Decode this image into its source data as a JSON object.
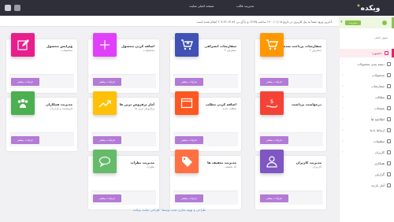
{
  "topbar": {
    "home_link": "صفحه اصلی سایت",
    "template_link": "مدیریت قالب",
    "logo_text": "ویکده"
  },
  "sidebar": {
    "user_badge": "مدیریت",
    "section_header": "منوی اصلی",
    "items": [
      {
        "label": "داشبورد"
      },
      {
        "label": "دسته بندی محصولات"
      },
      {
        "label": "محصولات"
      },
      {
        "label": "سفارشات"
      },
      {
        "label": "مطالب"
      },
      {
        "label": "صفحات"
      },
      {
        "label": "اطلاعیه ها"
      },
      {
        "label": "ارتباط با ما"
      },
      {
        "label": "تنظیمات"
      },
      {
        "label": "کاربران"
      },
      {
        "label": "همکاری"
      },
      {
        "label": "گزارش"
      },
      {
        "label": "آمار بازدید"
      }
    ]
  },
  "notice": "آخرین ورود شما به پنل کاربری در تاریخ ۱۴۰۰/۰۱/۰۵ ساعت ۱۳:۳۵ و با آی پی ۲۰۷.۴۶.۱۳.۸۴ انجام شده است.",
  "detail_button": "جزئیات بیشتر",
  "cards": [
    {
      "title": "سفارشات پرداخت شده",
      "sub": "۲ سفارش",
      "color": "#ff9800",
      "icon": "cart-icon"
    },
    {
      "title": "سفارشات انصرافی",
      "sub": "۳ سفارش",
      "color": "#3f51b5",
      "icon": "cart-remove-icon"
    },
    {
      "title": "اضافه کردن محصول",
      "sub": "محصولات",
      "color": "#e040fb",
      "icon": "plus-icon"
    },
    {
      "title": "ویرایش محصول",
      "sub": "محصولات",
      "color": "#e91e8c",
      "icon": "edit-icon"
    },
    {
      "title": "درخواست برداشت",
      "sub": "",
      "color": "#f44336",
      "icon": "money-hand-icon"
    },
    {
      "title": "اضافه کردن مطلب",
      "sub": "مطلب جدید",
      "color": "#ff5722",
      "icon": "browser-icon"
    },
    {
      "title": "آمار پرفروش ترین ها",
      "sub": "پرفروش ترین ها",
      "color": "#ffc107",
      "icon": "trend-icon"
    },
    {
      "title": "مدیریت همکاران",
      "sub": "فروشنده و بازاریاب",
      "color": "#4caf50",
      "icon": "group-icon"
    },
    {
      "title": "مدیریت کاربران",
      "sub": "کاربران",
      "color": "#7e57c2",
      "icon": "user-icon"
    },
    {
      "title": "مدیریت تخفیف ها",
      "sub": "کد تخفیف",
      "color": "#ff7043",
      "icon": "tag-icon"
    },
    {
      "title": "مدیریت نظرات",
      "sub": "نظرات",
      "color": "#66bb6a",
      "icon": "comment-icon"
    }
  ],
  "footer": "طراحی و بهینه سازی شده توسط: طراحی سایت ویکده"
}
